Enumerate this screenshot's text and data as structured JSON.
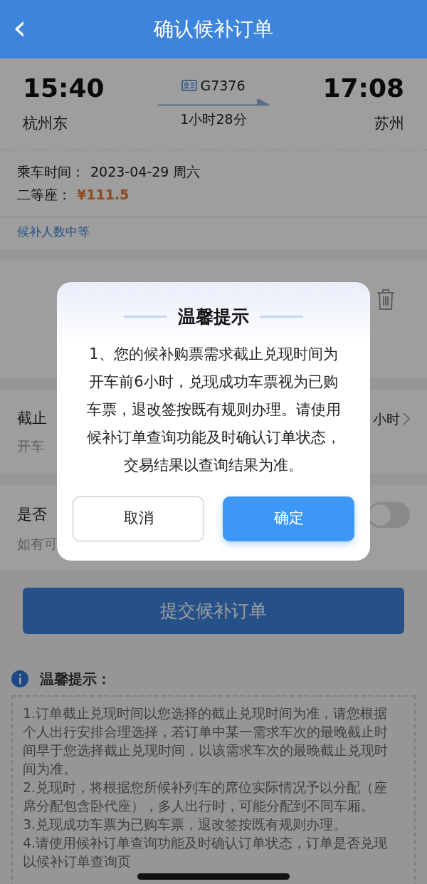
{
  "header": {
    "back": "‹",
    "title": "确认候补订单"
  },
  "trip": {
    "depart_time": "15:40",
    "depart_station": "杭州东",
    "train_no": "G7376",
    "duration": "1小时28分",
    "arrive_time": "17:08",
    "arrive_station": "苏州"
  },
  "ride": {
    "date_label": "乘车时间：",
    "date": "2023-04-29 周六",
    "seat_label": "二等座：",
    "price": "¥111.5"
  },
  "queue_level": "候补人数中等",
  "deadline": {
    "label": "截止",
    "value": "小时",
    "hint": "开车"
  },
  "option": {
    "label": "是否",
    "hint": "如有可",
    "on": false
  },
  "submit": "提交候补订单",
  "tips": {
    "title": "温馨提示：",
    "notes": [
      "1.订单截止兑现时间以您选择的截止兑现时间为准，请您根据个人出行安排合理选择，若订单中某一需求车次的最晚截止时间早于您选择截止兑现时间，以该需求车次的最晚截止兑现时间为准。",
      "2.兑现时，将根据您所候补列车的席位实际情况予以分配（座席分配包含卧代座），多人出行时，可能分配到不同车厢。",
      "3.兑现成功车票为已购车票，退改签按既有规则办理。",
      "4.请使用候补订单查询功能及时确认订单状态，订单是否兑现以候补订单查询页"
    ]
  },
  "dialog": {
    "title": "温馨提示",
    "body": "1、您的候补购票需求截止兑现时间为开车前6小时，兑现成功车票视为已购车票，退改签按既有规则办理。请使用候补订单查询功能及时确认订单状态，交易结果以查询结果为准。",
    "buttons": [
      {
        "label": "取消",
        "kind": "secondary"
      },
      {
        "label": "确定",
        "kind": "primary"
      }
    ]
  }
}
